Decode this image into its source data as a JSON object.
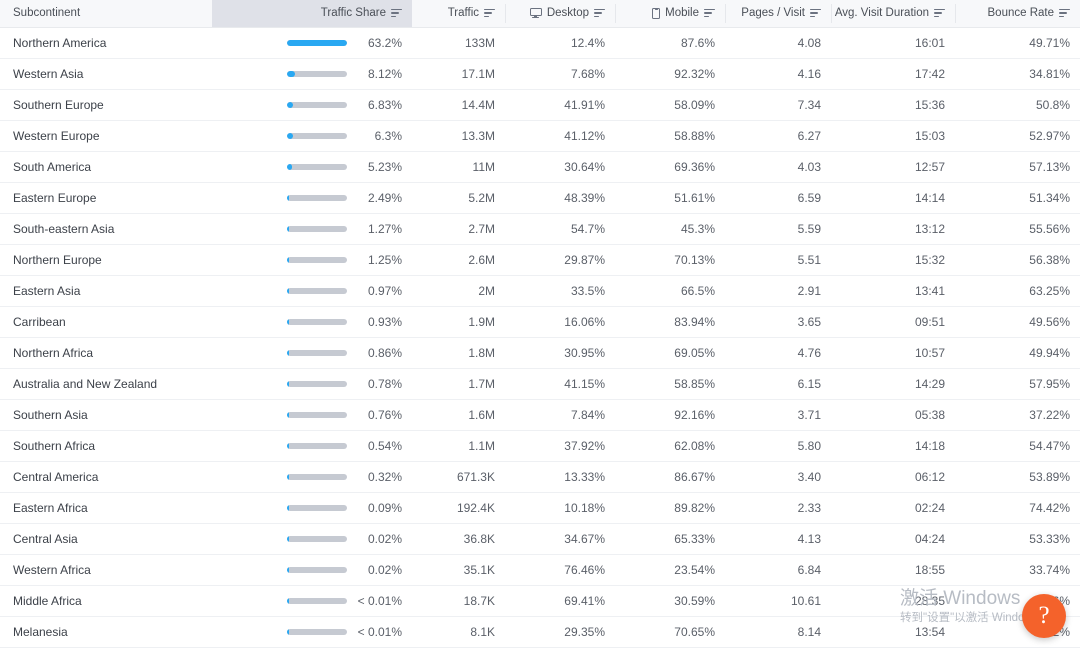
{
  "table": {
    "columns": [
      {
        "key": "subcontinent",
        "label": "Subcontinent",
        "align": "left",
        "icon": null,
        "sorted": false
      },
      {
        "key": "traffic_share",
        "label": "Traffic Share",
        "align": "right",
        "icon": null,
        "sorted": true
      },
      {
        "key": "traffic",
        "label": "Traffic",
        "align": "right",
        "icon": null,
        "sorted": false
      },
      {
        "key": "desktop",
        "label": "Desktop",
        "align": "right",
        "icon": "monitor-icon",
        "sorted": false
      },
      {
        "key": "mobile",
        "label": "Mobile",
        "align": "right",
        "icon": "phone-icon",
        "sorted": false
      },
      {
        "key": "pages_visit",
        "label": "Pages / Visit",
        "align": "right",
        "icon": null,
        "sorted": false
      },
      {
        "key": "avg_visit_duration",
        "label": "Avg. Visit Duration",
        "align": "right",
        "icon": null,
        "sorted": false
      },
      {
        "key": "bounce_rate",
        "label": "Bounce Rate",
        "align": "right",
        "icon": null,
        "sorted": false
      }
    ],
    "filter_icon": "filter-icon",
    "rows": [
      {
        "subcontinent": "Northern America",
        "traffic_share": "63.2%",
        "share_pct": 63.2,
        "traffic": "133M",
        "desktop": "12.4%",
        "mobile": "87.6%",
        "pages_visit": "4.08",
        "avg_visit_duration": "16:01",
        "bounce_rate": "49.71%"
      },
      {
        "subcontinent": "Western Asia",
        "traffic_share": "8.12%",
        "share_pct": 8.12,
        "traffic": "17.1M",
        "desktop": "7.68%",
        "mobile": "92.32%",
        "pages_visit": "4.16",
        "avg_visit_duration": "17:42",
        "bounce_rate": "34.81%"
      },
      {
        "subcontinent": "Southern Europe",
        "traffic_share": "6.83%",
        "share_pct": 6.83,
        "traffic": "14.4M",
        "desktop": "41.91%",
        "mobile": "58.09%",
        "pages_visit": "7.34",
        "avg_visit_duration": "15:36",
        "bounce_rate": "50.8%"
      },
      {
        "subcontinent": "Western Europe",
        "traffic_share": "6.3%",
        "share_pct": 6.3,
        "traffic": "13.3M",
        "desktop": "41.12%",
        "mobile": "58.88%",
        "pages_visit": "6.27",
        "avg_visit_duration": "15:03",
        "bounce_rate": "52.97%"
      },
      {
        "subcontinent": "South America",
        "traffic_share": "5.23%",
        "share_pct": 5.23,
        "traffic": "11M",
        "desktop": "30.64%",
        "mobile": "69.36%",
        "pages_visit": "4.03",
        "avg_visit_duration": "12:57",
        "bounce_rate": "57.13%"
      },
      {
        "subcontinent": "Eastern Europe",
        "traffic_share": "2.49%",
        "share_pct": 2.49,
        "traffic": "5.2M",
        "desktop": "48.39%",
        "mobile": "51.61%",
        "pages_visit": "6.59",
        "avg_visit_duration": "14:14",
        "bounce_rate": "51.34%"
      },
      {
        "subcontinent": "South-eastern Asia",
        "traffic_share": "1.27%",
        "share_pct": 1.27,
        "traffic": "2.7M",
        "desktop": "54.7%",
        "mobile": "45.3%",
        "pages_visit": "5.59",
        "avg_visit_duration": "13:12",
        "bounce_rate": "55.56%"
      },
      {
        "subcontinent": "Northern Europe",
        "traffic_share": "1.25%",
        "share_pct": 1.25,
        "traffic": "2.6M",
        "desktop": "29.87%",
        "mobile": "70.13%",
        "pages_visit": "5.51",
        "avg_visit_duration": "15:32",
        "bounce_rate": "56.38%"
      },
      {
        "subcontinent": "Eastern Asia",
        "traffic_share": "0.97%",
        "share_pct": 0.97,
        "traffic": "2M",
        "desktop": "33.5%",
        "mobile": "66.5%",
        "pages_visit": "2.91",
        "avg_visit_duration": "13:41",
        "bounce_rate": "63.25%"
      },
      {
        "subcontinent": "Carribean",
        "traffic_share": "0.93%",
        "share_pct": 0.93,
        "traffic": "1.9M",
        "desktop": "16.06%",
        "mobile": "83.94%",
        "pages_visit": "3.65",
        "avg_visit_duration": "09:51",
        "bounce_rate": "49.56%"
      },
      {
        "subcontinent": "Northern Africa",
        "traffic_share": "0.86%",
        "share_pct": 0.86,
        "traffic": "1.8M",
        "desktop": "30.95%",
        "mobile": "69.05%",
        "pages_visit": "4.76",
        "avg_visit_duration": "10:57",
        "bounce_rate": "49.94%"
      },
      {
        "subcontinent": "Australia and New Zealand",
        "traffic_share": "0.78%",
        "share_pct": 0.78,
        "traffic": "1.7M",
        "desktop": "41.15%",
        "mobile": "58.85%",
        "pages_visit": "6.15",
        "avg_visit_duration": "14:29",
        "bounce_rate": "57.95%"
      },
      {
        "subcontinent": "Southern Asia",
        "traffic_share": "0.76%",
        "share_pct": 0.76,
        "traffic": "1.6M",
        "desktop": "7.84%",
        "mobile": "92.16%",
        "pages_visit": "3.71",
        "avg_visit_duration": "05:38",
        "bounce_rate": "37.22%"
      },
      {
        "subcontinent": "Southern Africa",
        "traffic_share": "0.54%",
        "share_pct": 0.54,
        "traffic": "1.1M",
        "desktop": "37.92%",
        "mobile": "62.08%",
        "pages_visit": "5.80",
        "avg_visit_duration": "14:18",
        "bounce_rate": "54.47%"
      },
      {
        "subcontinent": "Central America",
        "traffic_share": "0.32%",
        "share_pct": 0.32,
        "traffic": "671.3K",
        "desktop": "13.33%",
        "mobile": "86.67%",
        "pages_visit": "3.40",
        "avg_visit_duration": "06:12",
        "bounce_rate": "53.89%"
      },
      {
        "subcontinent": "Eastern Africa",
        "traffic_share": "0.09%",
        "share_pct": 0.09,
        "traffic": "192.4K",
        "desktop": "10.18%",
        "mobile": "89.82%",
        "pages_visit": "2.33",
        "avg_visit_duration": "02:24",
        "bounce_rate": "74.42%"
      },
      {
        "subcontinent": "Central Asia",
        "traffic_share": "0.02%",
        "share_pct": 0.02,
        "traffic": "36.8K",
        "desktop": "34.67%",
        "mobile": "65.33%",
        "pages_visit": "4.13",
        "avg_visit_duration": "04:24",
        "bounce_rate": "53.33%"
      },
      {
        "subcontinent": "Western Africa",
        "traffic_share": "0.02%",
        "share_pct": 0.02,
        "traffic": "35.1K",
        "desktop": "76.46%",
        "mobile": "23.54%",
        "pages_visit": "6.84",
        "avg_visit_duration": "18:55",
        "bounce_rate": "33.74%"
      },
      {
        "subcontinent": "Middle Africa",
        "traffic_share": "< 0.01%",
        "share_pct": 0.01,
        "traffic": "18.7K",
        "desktop": "69.41%",
        "mobile": "30.59%",
        "pages_visit": "10.61",
        "avg_visit_duration": "28:35",
        "bounce_rate": "53.6%"
      },
      {
        "subcontinent": "Melanesia",
        "traffic_share": "< 0.01%",
        "share_pct": 0.01,
        "traffic": "8.1K",
        "desktop": "29.35%",
        "mobile": "70.65%",
        "pages_visit": "8.14",
        "avg_visit_duration": "13:54",
        "bounce_rate": "3.72%"
      }
    ]
  },
  "watermark": {
    "line1": "激活 Windows",
    "line2": "转到\"设置\"以激活 Windows。"
  },
  "help_button": {
    "label": "?"
  },
  "colors": {
    "bar_fill": "#29a8f2",
    "bar_track": "#c6cad2",
    "header_bg": "#f7f8fa",
    "sorted_header_bg": "#dfe1e8",
    "help_fab": "#f4622b"
  }
}
